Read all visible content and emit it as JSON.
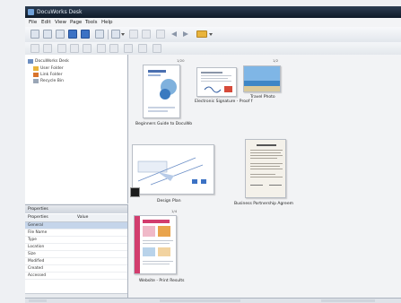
{
  "window": {
    "title": "DocuWorks Desk"
  },
  "menu": {
    "items": [
      "File",
      "Edit",
      "View",
      "Page",
      "Tools",
      "Help"
    ]
  },
  "tree": {
    "root": "DocuWorks Desk",
    "items": [
      "User Folder",
      "Link Folder",
      "Recycle Bin"
    ]
  },
  "properties": {
    "title": "Properties",
    "columns": [
      "Properties",
      "Value"
    ],
    "rows": [
      "General",
      "File Name",
      "Type",
      "Location",
      "Size",
      "Modified",
      "Created",
      "Accessed"
    ]
  },
  "documents": [
    {
      "label": "Beginners Guide to DocuWo",
      "pages": "1/20"
    },
    {
      "label": "Electronic Signature - Proof f",
      "pages": ""
    },
    {
      "label": "Travel Photo",
      "pages": "1/2"
    },
    {
      "label": "Design Plan",
      "pages": ""
    },
    {
      "label": "Business Partnership Agreem",
      "pages": ""
    },
    {
      "label": "Website - Print Results",
      "pages": "1/4"
    }
  ],
  "colors": {
    "titlebar": "#1a2738",
    "accent": "#3c72c4",
    "folder": "#e9b43c",
    "selection": "#c5d5ea"
  }
}
